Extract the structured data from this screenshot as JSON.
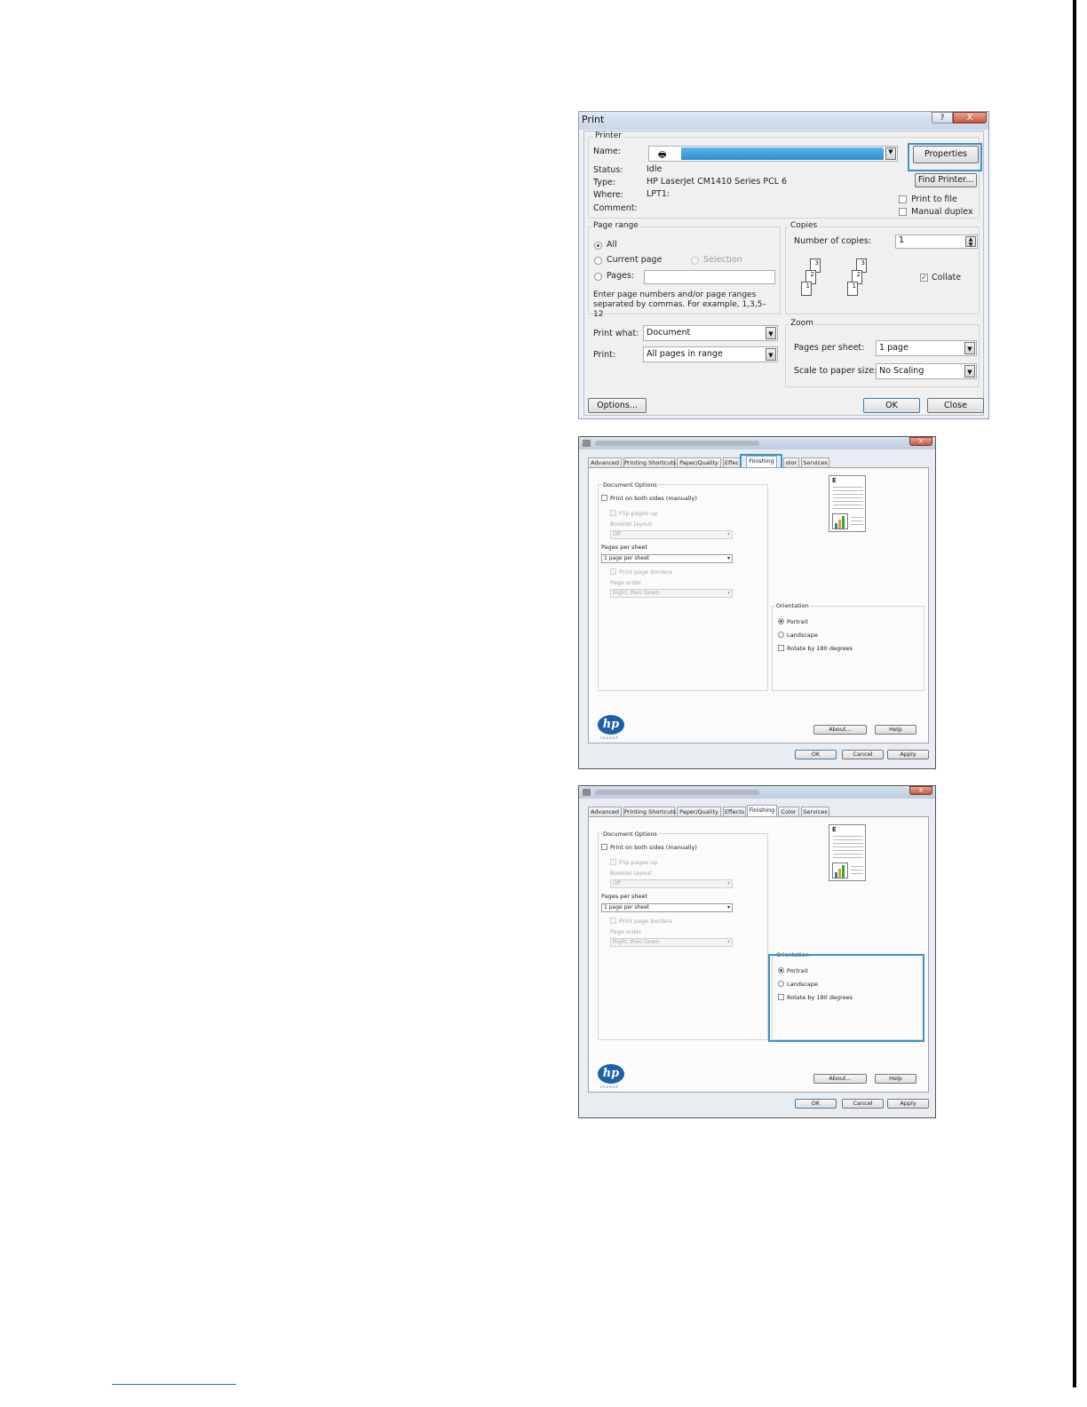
{
  "print_dialog": {
    "title": "Print",
    "title_buttons": {
      "help": "?",
      "close": "X"
    },
    "printer": {
      "group_label": "Printer",
      "name_label": "Name:",
      "status_label": "Status:",
      "status_value": "Idle",
      "type_label": "Type:",
      "type_value": "HP LaserJet CM1410 Series PCL 6",
      "where_label": "Where:",
      "where_value": "LPT1:",
      "comment_label": "Comment:",
      "properties_button": "Properties",
      "find_printer_button": "Find Printer...",
      "print_to_file": "Print to file",
      "manual_duplex": "Manual duplex"
    },
    "page_range": {
      "group_label": "Page range",
      "all": "All",
      "current_page": "Current page",
      "selection": "Selection",
      "pages": "Pages:",
      "hint": "Enter page numbers and/or page ranges separated by commas.  For example, 1,3,5–12"
    },
    "copies": {
      "group_label": "Copies",
      "number_label": "Number of copies:",
      "number_value": "1",
      "collate": "Collate",
      "stack_a": [
        "3",
        "2",
        "1"
      ],
      "stack_b": [
        "3",
        "2",
        "1"
      ]
    },
    "print_what_label": "Print what:",
    "print_what_value": "Document",
    "print_label": "Print:",
    "print_value": "All pages in range",
    "zoom": {
      "group_label": "Zoom",
      "pages_per_sheet_label": "Pages per sheet:",
      "pages_per_sheet_value": "1 page",
      "scale_label": "Scale to paper size:",
      "scale_value": "No Scaling"
    },
    "options_button": "Options...",
    "ok_button": "OK",
    "close_button": "Close"
  },
  "properties_dialog": {
    "close": "X",
    "tabs": [
      "Advanced",
      "Printing Shortcuts",
      "Paper/Quality",
      "Effects",
      "Finishing",
      "Color",
      "Services"
    ],
    "tabs_cropped": [
      "Advanced",
      "Printing Shortcuts",
      "Paper/Quality",
      "Effec",
      "Finishing",
      "olor",
      "Services"
    ],
    "document_options": {
      "group_label": "Document Options",
      "print_both_sides": "Print on both sides (manually)",
      "flip_pages_up": "Flip pages up",
      "booklet_layout": "Booklet layout",
      "booklet_value": "Off",
      "pages_per_sheet_label": "Pages per sheet",
      "pages_per_sheet_value": "1 page per sheet",
      "print_page_borders": "Print page borders",
      "page_order_label": "Page order",
      "page_order_value": "Right, then Down"
    },
    "orientation": {
      "group_label": "Orientation",
      "portrait": "Portrait",
      "landscape": "Landscape",
      "rotate": "Rotate by 180 degrees"
    },
    "preview_letter": "E",
    "hp_logo": "hp",
    "hp_tagline": "invent",
    "about_button": "About...",
    "help_button": "Help",
    "ok_button": "OK",
    "cancel_button": "Cancel",
    "apply_button": "Apply"
  },
  "colors": {
    "highlight": "#3a94c8",
    "hp_blue": "#1d5fa8",
    "selection_blue": "#2d8fd1"
  }
}
